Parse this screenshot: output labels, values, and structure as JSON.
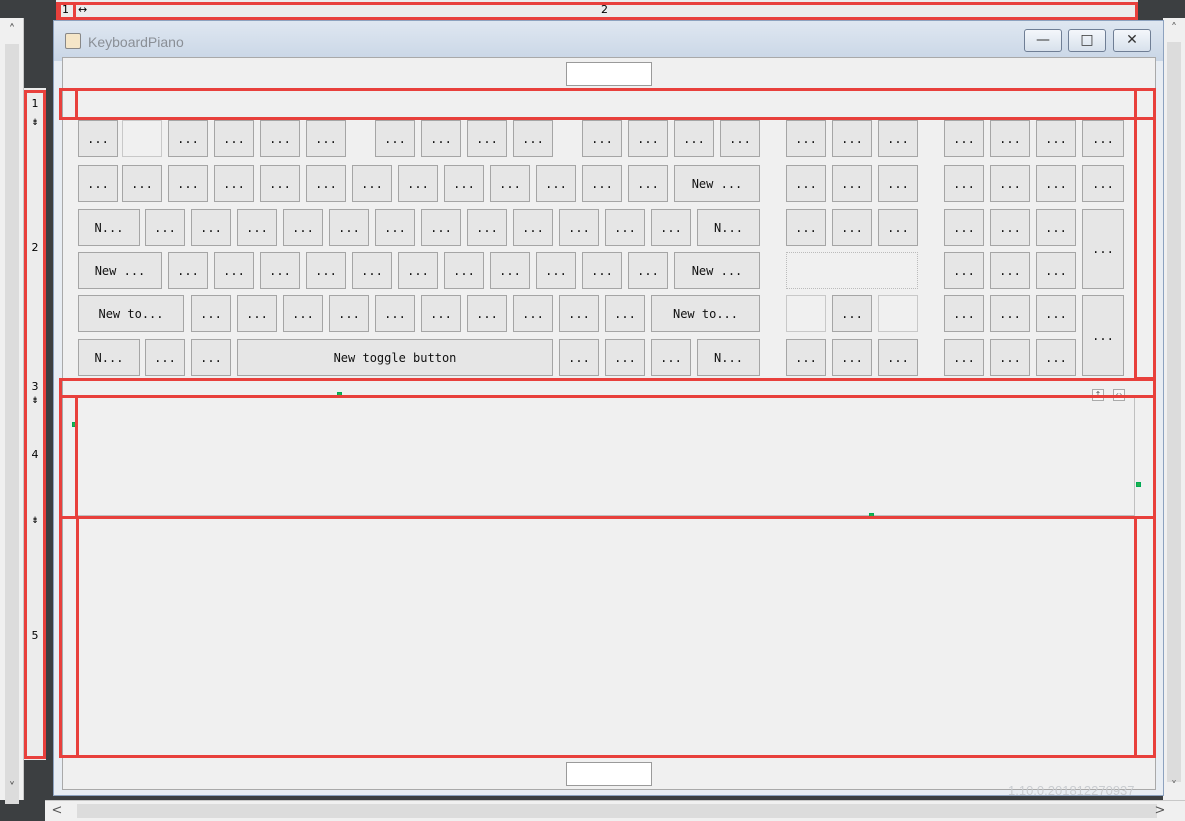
{
  "column_ruler": {
    "labels": [
      "1",
      "2"
    ],
    "resize_glyph": "↔"
  },
  "row_ruler": {
    "labels": [
      "1",
      "2",
      "3",
      "4",
      "5"
    ],
    "resize_glyph": "⇟"
  },
  "window": {
    "title": "KeyboardPiano",
    "minimize": "—",
    "maximize": "□",
    "close": "✕"
  },
  "keys": {
    "ellipsis": "...",
    "n_short": "N...",
    "new_short": "New ...",
    "new_to": "New to...",
    "toggle_full": "New toggle button"
  },
  "scroll": {
    "up": "˄",
    "down": "˅",
    "left": "<",
    "right": ">"
  },
  "watermark": "1.10.0.201812270937"
}
